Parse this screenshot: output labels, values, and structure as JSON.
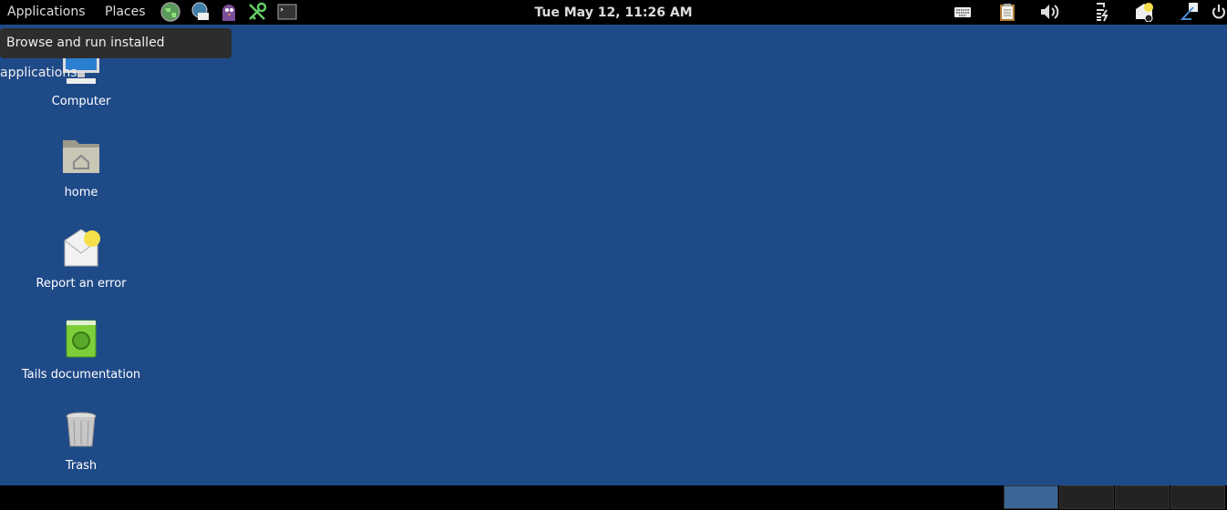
{
  "topbar": {
    "applications_label": "Applications",
    "places_label": "Places",
    "launchers": [
      "tor-browser-icon",
      "email-client-icon",
      "pidgin-icon",
      "keepassx-icon",
      "terminal-icon"
    ],
    "clock": "Tue May 12, 11:26 AM",
    "tray": [
      "keyboard-icon",
      "clipboard-icon",
      "volume-icon",
      "network-icon",
      "notification-icon",
      "accessibility-icon",
      "power-icon"
    ]
  },
  "tooltip": {
    "text": "Browse and run installed applications"
  },
  "desktop": {
    "icons": [
      {
        "label": "Computer",
        "icon": "computer-icon"
      },
      {
        "label": "home",
        "icon": "home-folder-icon"
      },
      {
        "label": "Report an error",
        "icon": "report-error-icon"
      },
      {
        "label": "Tails documentation",
        "icon": "documentation-icon"
      },
      {
        "label": "Trash",
        "icon": "trash-icon"
      }
    ],
    "background_color": "#1f4a88"
  },
  "workspaces": {
    "count": 4,
    "active": 1
  }
}
